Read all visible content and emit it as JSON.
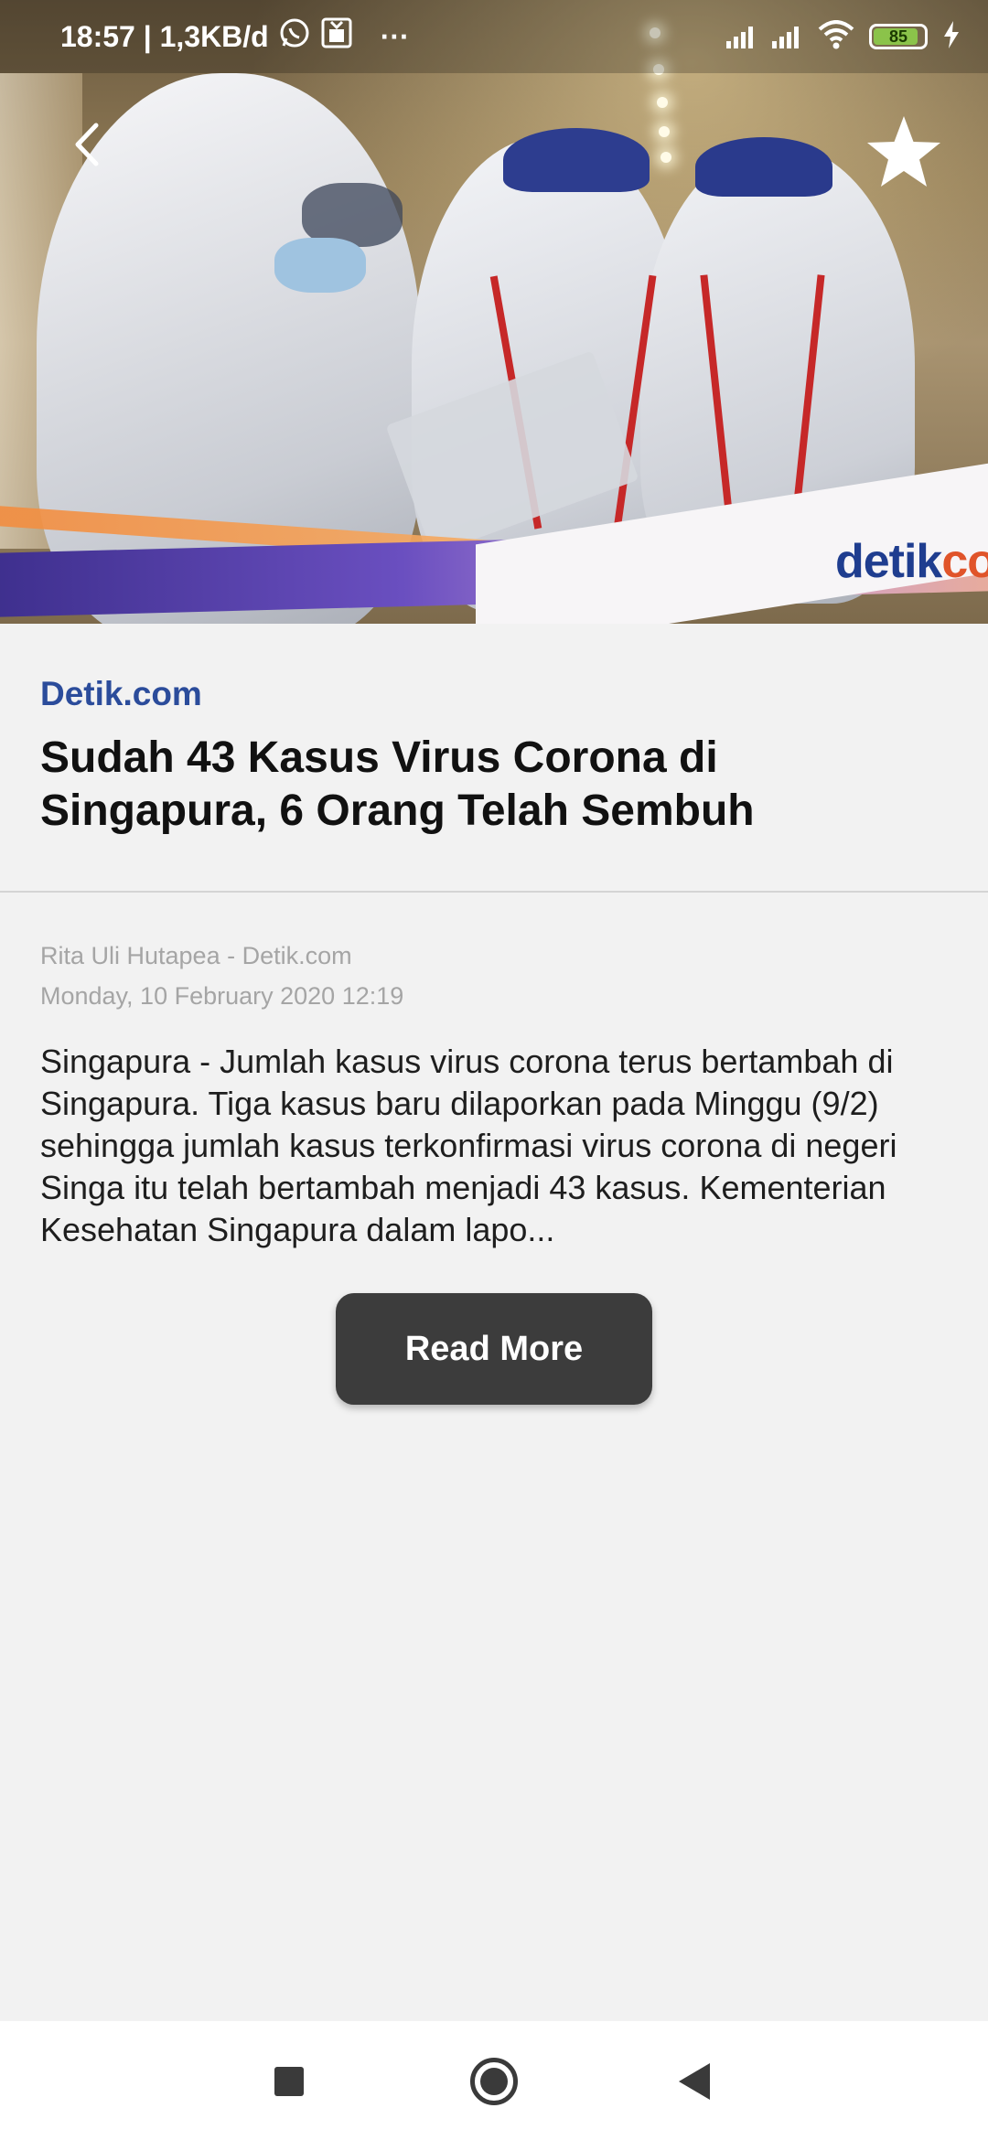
{
  "status_bar": {
    "time_speed": "18:57 | 1,3KB/d",
    "more_dots": "···",
    "battery_level": "85",
    "icons": [
      "whatsapp-icon",
      "notification-app-icon",
      "signal-icon",
      "signal-icon",
      "wifi-icon",
      "battery-icon",
      "charging-icon"
    ]
  },
  "hero": {
    "watermark_main": "detik",
    "watermark_suffix": "co"
  },
  "toolbar": {
    "back_icon": "chevron-left-icon",
    "favorite_icon": "star-icon"
  },
  "article": {
    "source": "Detik.com",
    "title": "Sudah 43 Kasus Virus Corona di Singapura, 6 Orang Telah Sembuh",
    "author": "Rita Uli Hutapea - Detik.com",
    "date": "Monday, 10 February 2020 12:19",
    "excerpt": "Singapura - Jumlah kasus virus corona terus bertambah di Singapura. Tiga kasus baru dilaporkan pada Minggu (9/2) sehingga jumlah kasus terkonfirmasi virus corona di negeri Singa itu telah bertambah menjadi 43 kasus. Kementerian Kesehatan Singapura dalam lapo...",
    "read_more_label": "Read More"
  },
  "nav_bar": {
    "icons": [
      "recent-apps-icon",
      "home-icon",
      "back-icon"
    ]
  },
  "colors": {
    "source_link": "#2b4c9b",
    "button_bg": "#3c3c3c",
    "background": "#f2f2f2"
  }
}
